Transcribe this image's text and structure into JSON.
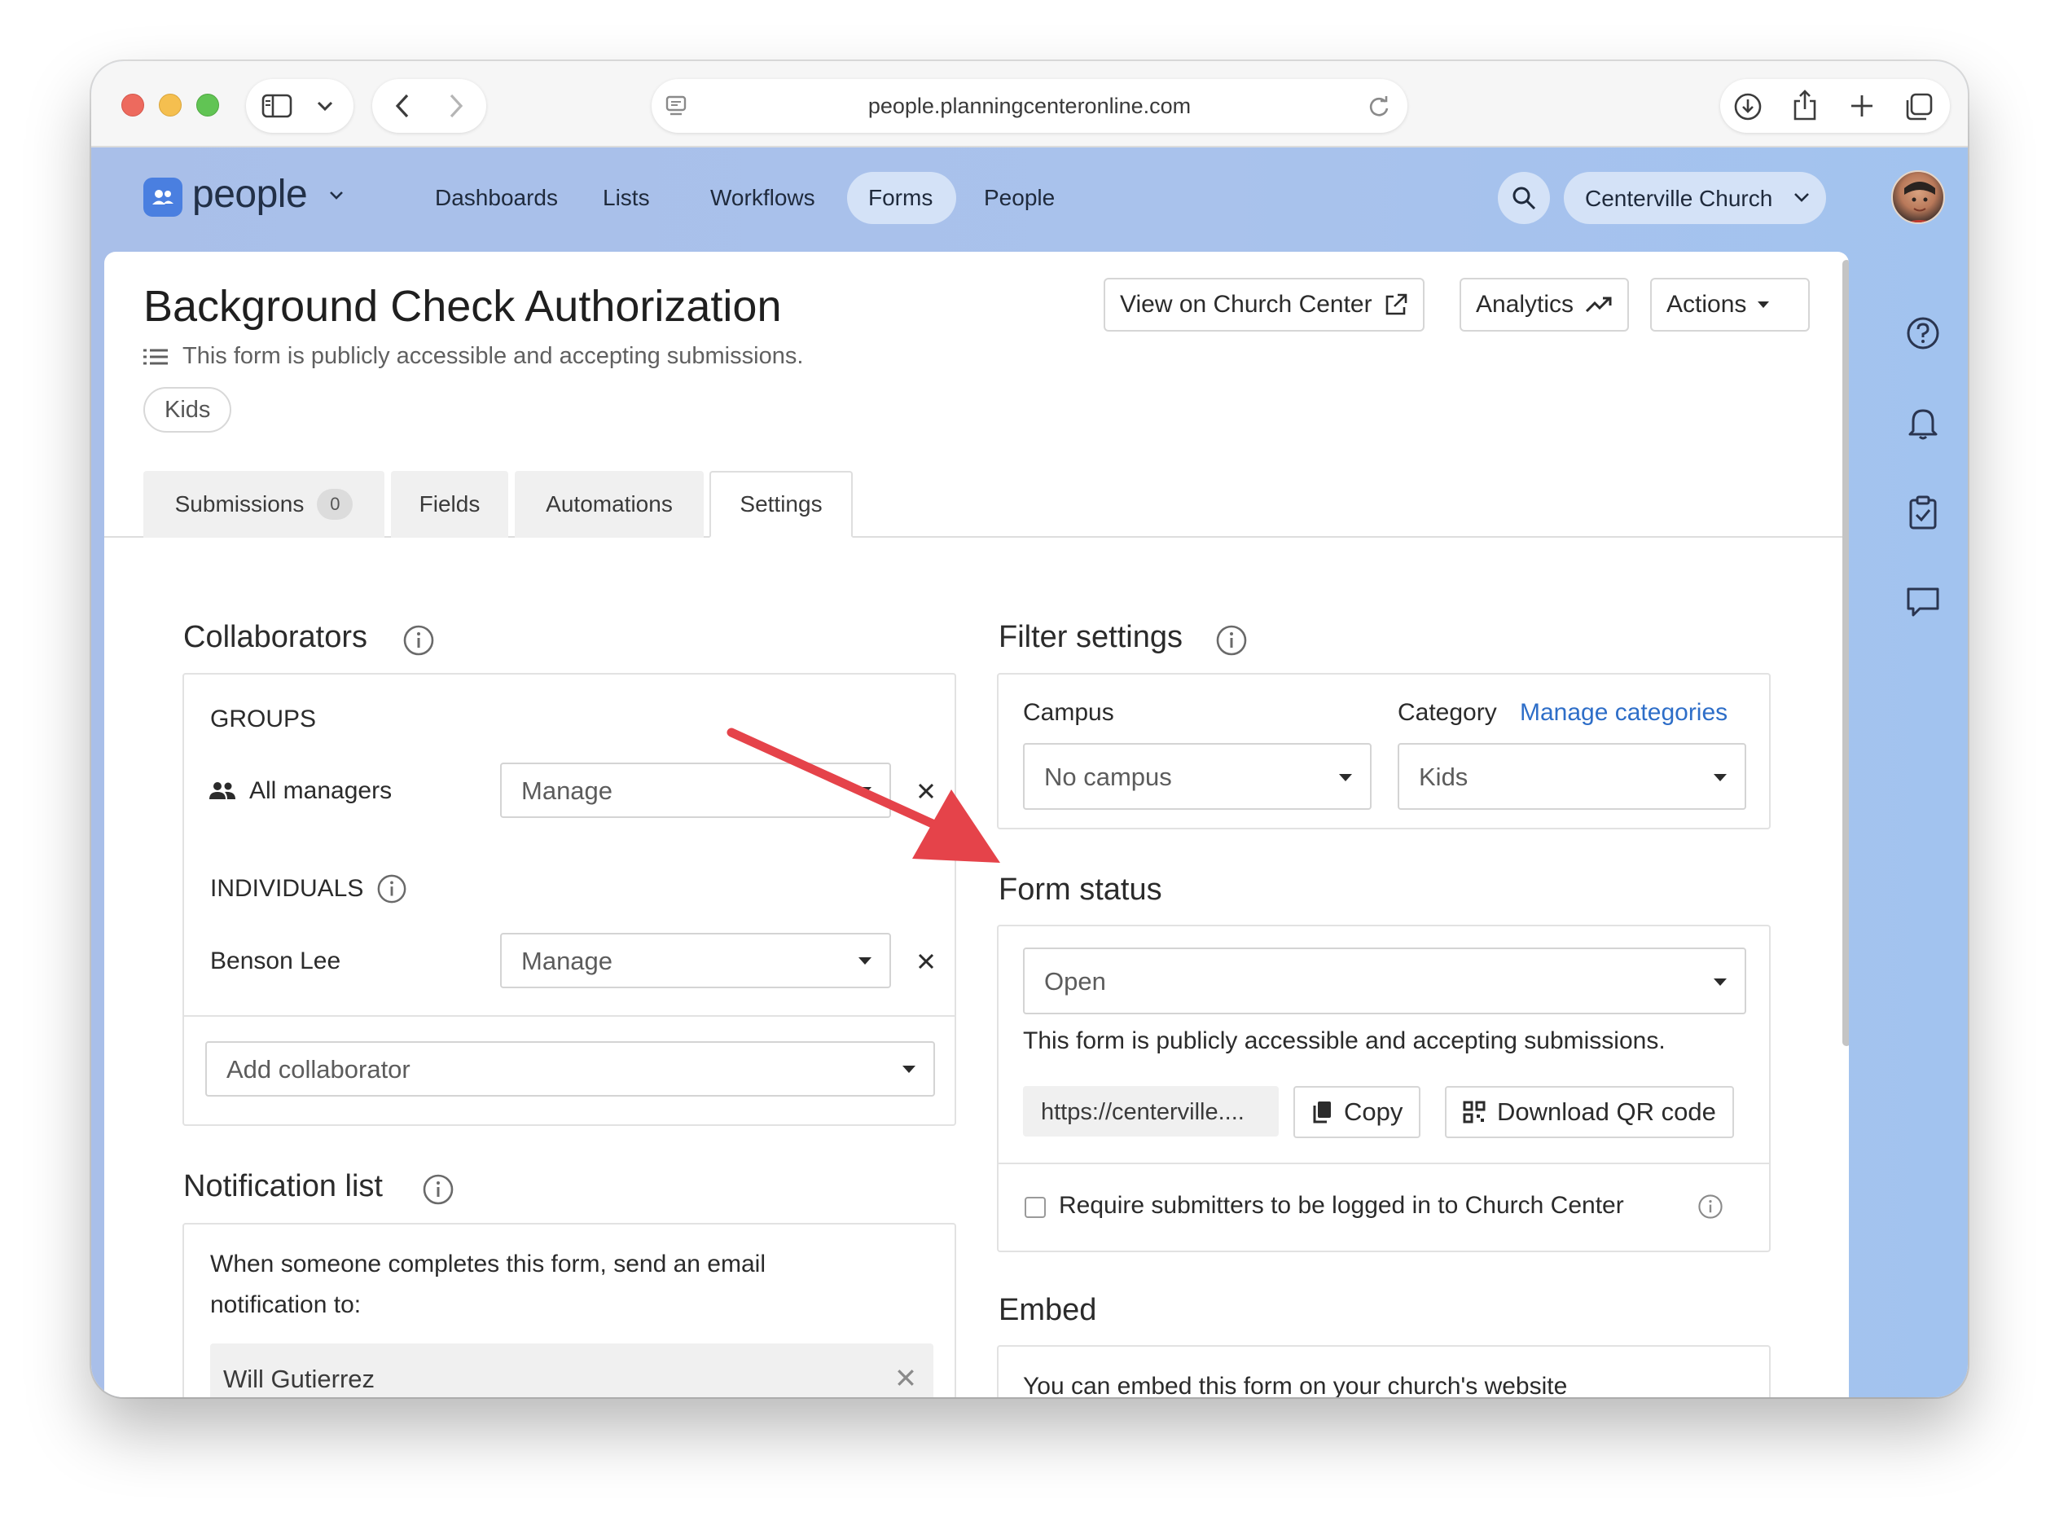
{
  "browser": {
    "url": "people.planningcenteronline.com"
  },
  "app": {
    "name": "people",
    "nav": [
      "Dashboards",
      "Lists",
      "Workflows",
      "Forms",
      "People"
    ],
    "active_nav": "Forms",
    "org": "Centerville Church",
    "accent": "#4a7fe0"
  },
  "header": {
    "title": "Background Check Authorization",
    "subtitle": "This form is publicly accessible and accepting submissions.",
    "tag": "Kids",
    "view_btn": "View on Church Center",
    "analytics_btn": "Analytics",
    "actions_btn": "Actions"
  },
  "tabs": {
    "submissions": "Submissions",
    "submissions_count": "0",
    "fields": "Fields",
    "automations": "Automations",
    "settings": "Settings",
    "active": "Settings"
  },
  "collaborators": {
    "title": "Collaborators",
    "groups_label": "GROUPS",
    "group_name": "All managers",
    "group_role": "Manage",
    "individuals_label": "INDIVIDUALS",
    "individual_name": "Benson Lee",
    "individual_role": "Manage",
    "add_placeholder": "Add collaborator"
  },
  "notification": {
    "title": "Notification list",
    "description": "When someone completes this form, send an email notification to:",
    "recipient": "Will Gutierrez"
  },
  "filter": {
    "title": "Filter settings",
    "campus_label": "Campus",
    "campus_value": "No campus",
    "category_label": "Category",
    "manage_link": "Manage categories",
    "category_value": "Kids"
  },
  "status": {
    "title": "Form status",
    "value": "Open",
    "message": "This form is publicly accessible and accepting submissions.",
    "url": "https://centerville....",
    "copy_btn": "Copy",
    "qr_btn": "Download QR code",
    "require_login": "Require submitters to be logged in to Church Center",
    "require_login_checked": false
  },
  "embed": {
    "title": "Embed",
    "text": "You can embed this form on your church's website"
  },
  "annotation_color": "#e5434a"
}
